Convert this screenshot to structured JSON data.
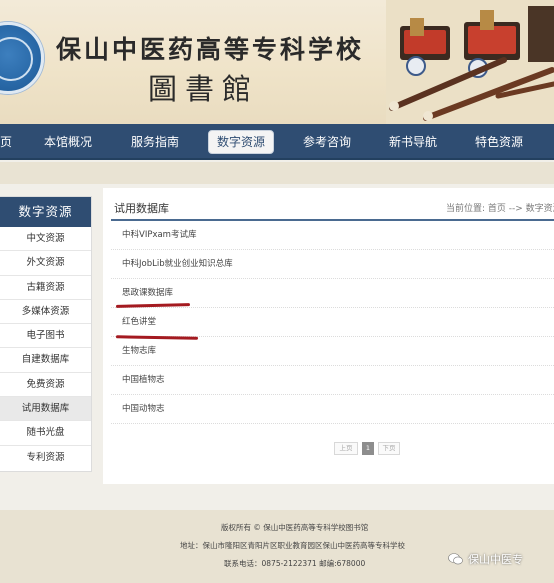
{
  "header": {
    "school_name": "保山中医药高等专科学校",
    "library_name": "圖書館"
  },
  "nav": {
    "items": [
      {
        "label": "首页"
      },
      {
        "label": "本馆概况"
      },
      {
        "label": "服务指南"
      },
      {
        "label": "数字资源"
      },
      {
        "label": "参考咨询"
      },
      {
        "label": "新书导航"
      },
      {
        "label": "特色资源"
      }
    ],
    "active": "数字资源"
  },
  "sidebar": {
    "title": "数字资源",
    "items": [
      {
        "label": "中文资源"
      },
      {
        "label": "外文资源"
      },
      {
        "label": "古籍资源"
      },
      {
        "label": "多媒体资源"
      },
      {
        "label": "电子图书"
      },
      {
        "label": "自建数据库"
      },
      {
        "label": "免费资源"
      },
      {
        "label": "试用数据库"
      },
      {
        "label": "随书光盘"
      },
      {
        "label": "专利资源"
      }
    ],
    "active": "试用数据库"
  },
  "main": {
    "title": "试用数据库",
    "breadcrumb": "当前位置: 首页 --> 数字资源",
    "databases": [
      {
        "label": "中科VIPxam考试库"
      },
      {
        "label": "中科JobLib就业创业知识总库"
      },
      {
        "label": "思政课数据库"
      },
      {
        "label": "红色讲堂"
      },
      {
        "label": "生物志库"
      },
      {
        "label": "中国植物志"
      },
      {
        "label": "中国动物志"
      }
    ],
    "underline_color": "#a41a20"
  },
  "pagination": {
    "prev_label": "上页",
    "current_page": "1",
    "next_label": "下页"
  },
  "footer": {
    "copyright": "版权所有 © 保山中医药高等专科学校图书馆",
    "address": "地址：保山市隆阳区青阳片区职业教育园区保山中医药高等专科学校",
    "contact": "联系电话：0875-2122371   邮编:678000"
  },
  "watermark": {
    "text": "保山中医专"
  },
  "colors": {
    "nav_bg": "#2f4d72",
    "page_bg": "#f1efe9",
    "accent_red": "#a41a20"
  }
}
